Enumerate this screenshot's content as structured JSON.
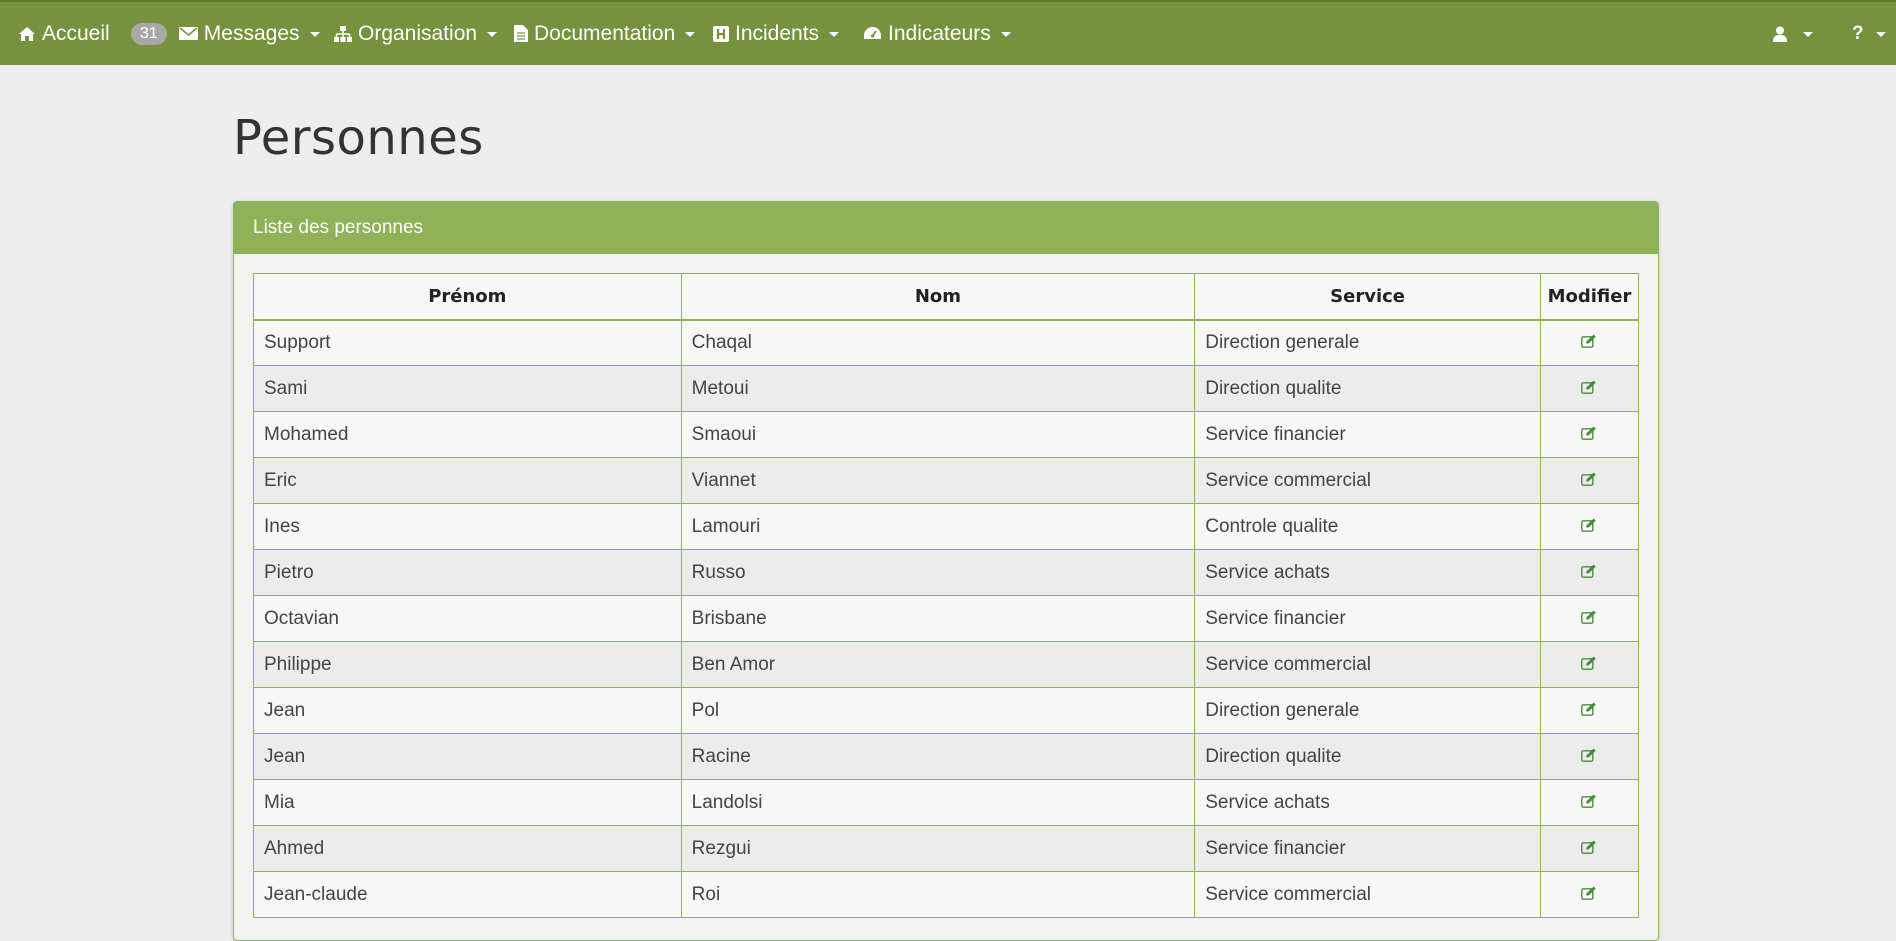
{
  "navbar": {
    "home_label": "Accueil",
    "messages_count": "31",
    "messages_label": "Messages",
    "organisation_label": "Organisation",
    "documentation_label": "Documentation",
    "incidents_label": "Incidents",
    "indicateurs_label": "Indicateurs",
    "colors": {
      "background": "#76923f",
      "panel_accent": "#8fb157"
    }
  },
  "page": {
    "title": "Personnes"
  },
  "panel": {
    "heading": "Liste des personnes"
  },
  "table": {
    "headers": [
      "Prénom",
      "Nom",
      "Service",
      "Modifier"
    ],
    "rows": [
      {
        "prenom": "Support",
        "nom": "Chaqal",
        "service": "Direction generale"
      },
      {
        "prenom": "Sami",
        "nom": "Metoui",
        "service": "Direction qualite"
      },
      {
        "prenom": "Mohamed",
        "nom": "Smaoui",
        "service": "Service financier"
      },
      {
        "prenom": "Eric",
        "nom": "Viannet",
        "service": "Service commercial"
      },
      {
        "prenom": "Ines",
        "nom": "Lamouri",
        "service": "Controle qualite"
      },
      {
        "prenom": "Pietro",
        "nom": "Russo",
        "service": "Service achats"
      },
      {
        "prenom": "Octavian",
        "nom": "Brisbane",
        "service": "Service financier"
      },
      {
        "prenom": "Philippe",
        "nom": "Ben Amor",
        "service": "Service commercial"
      },
      {
        "prenom": "Jean",
        "nom": "Pol",
        "service": "Direction generale"
      },
      {
        "prenom": "Jean",
        "nom": "Racine",
        "service": "Direction qualite"
      },
      {
        "prenom": "Mia",
        "nom": "Landolsi",
        "service": "Service achats"
      },
      {
        "prenom": "Ahmed",
        "nom": "Rezgui",
        "service": "Service financier"
      },
      {
        "prenom": "Jean-claude",
        "nom": "Roi",
        "service": "Service commercial"
      }
    ],
    "edit_icon": "edit-icon"
  }
}
